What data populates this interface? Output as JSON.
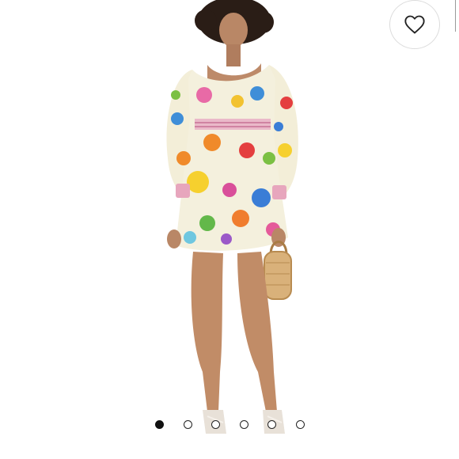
{
  "listing": {
    "liked": false,
    "icons": {
      "like": "heart-outline-icon"
    }
  },
  "gallery": {
    "image_count": 6,
    "active_index": 0
  },
  "colors": {
    "background": "#ffffff",
    "dot_active": "#111111",
    "dot_inactive_border": "#222222"
  }
}
